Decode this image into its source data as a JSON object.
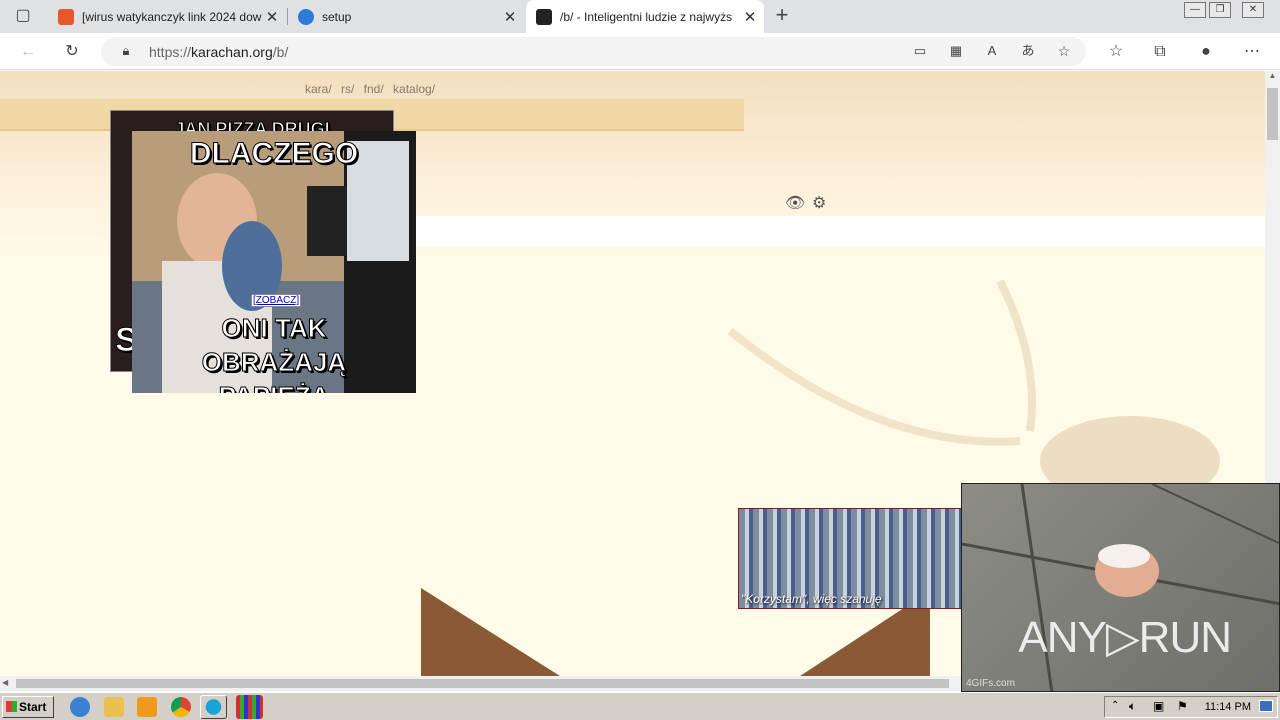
{
  "browser": {
    "tabs": [
      {
        "title": "[wirus watykanczyk link 2024 dow"
      },
      {
        "title": "setup"
      },
      {
        "title": "/b/ - Inteligentni ludzie z najwyżs"
      }
    ],
    "new_tab_symbol": "+",
    "url_prefix": "https://",
    "url_host": "karachan.org",
    "url_path": "/b/"
  },
  "page": {
    "board_nav": "kara/  rs/  fnd/  katalog/",
    "meme1_top": "JAN PIZZA DRUGI",
    "meme1_bottom": "S",
    "meme2_top": "DLACZEGO",
    "meme2_bottom": "ONI TAK OBRAŻAJĄ PAPIEŻA",
    "zobacz": "[ZOBACZ]",
    "server_caption": "\"Korzystam\", więc szanuję"
  },
  "overlay": {
    "brand": "ANY▷RUN",
    "gif_credit": "4GIFs.com"
  },
  "taskbar": {
    "start": "Start",
    "clock": "11:14 PM"
  },
  "colors": {
    "tab_strip": "#dfe1e5",
    "page_bg": "#fffbe8",
    "header_bar": "#f0d9a6",
    "bug_brown": "#8a5a36"
  }
}
